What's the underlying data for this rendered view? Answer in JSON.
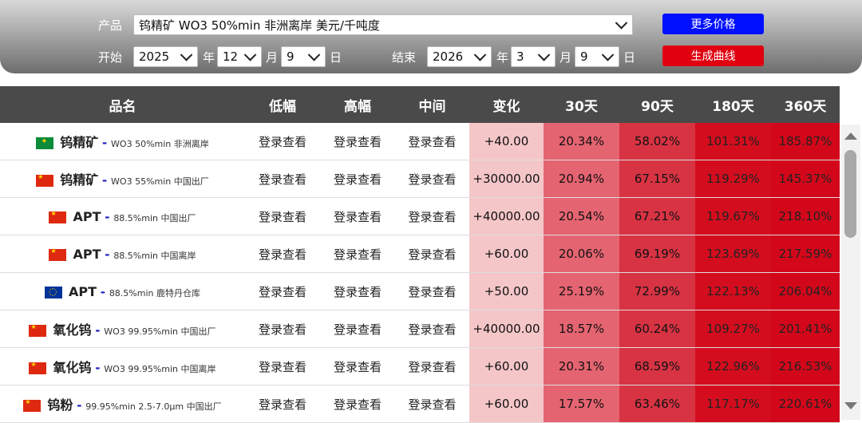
{
  "filters": {
    "product_label": "产品",
    "product_value": "钨精矿 WO3 50%min 非洲离岸 美元/千吨度",
    "start_label": "开始",
    "start_year": "2025",
    "start_month": "12",
    "start_day": "9",
    "end_label": "结束",
    "end_year": "2026",
    "end_month": "3",
    "end_day": "9",
    "year_unit": "年",
    "month_unit": "月",
    "day_unit": "日",
    "more_prices_button": "更多价格",
    "generate_curve_button": "生成曲线"
  },
  "table": {
    "headers": [
      "品名",
      "低幅",
      "高幅",
      "中间",
      "变化",
      "30天",
      "90天",
      "180天",
      "360天"
    ],
    "rows": [
      {
        "flag": "za-flag-icon",
        "name": "钨精矿",
        "spec": "WO3 50%min 非洲离岸",
        "low": "登录查看",
        "high": "登录查看",
        "mid": "登录查看",
        "change": "+40.00",
        "d30": "20.34%",
        "d90": "58.02%",
        "d180": "101.31%",
        "d360": "185.87%"
      },
      {
        "flag": "cn-flag-icon",
        "name": "钨精矿",
        "spec": "WO3 55%min 中国出厂",
        "low": "登录查看",
        "high": "登录查看",
        "mid": "登录查看",
        "change": "+30000.00",
        "d30": "20.94%",
        "d90": "67.15%",
        "d180": "119.29%",
        "d360": "145.37%"
      },
      {
        "flag": "cn-flag-icon",
        "name": "APT",
        "spec": "88.5%min 中国出厂",
        "low": "登录查看",
        "high": "登录查看",
        "mid": "登录查看",
        "change": "+40000.00",
        "d30": "20.54%",
        "d90": "67.21%",
        "d180": "119.67%",
        "d360": "218.10%"
      },
      {
        "flag": "cn-flag-icon",
        "name": "APT",
        "spec": "88.5%min 中国离岸",
        "low": "登录查看",
        "high": "登录查看",
        "mid": "登录查看",
        "change": "+60.00",
        "d30": "20.06%",
        "d90": "69.19%",
        "d180": "123.69%",
        "d360": "217.59%"
      },
      {
        "flag": "eu-flag-icon",
        "name": "APT",
        "spec": "88.5%min 鹿特丹仓库",
        "low": "登录查看",
        "high": "登录查看",
        "mid": "登录查看",
        "change": "+50.00",
        "d30": "25.19%",
        "d90": "72.99%",
        "d180": "122.13%",
        "d360": "206.04%"
      },
      {
        "flag": "cn-flag-icon",
        "name": "氧化钨",
        "spec": "WO3 99.95%min 中国出厂",
        "low": "登录查看",
        "high": "登录查看",
        "mid": "登录查看",
        "change": "+40000.00",
        "d30": "18.57%",
        "d90": "60.24%",
        "d180": "109.27%",
        "d360": "201.41%"
      },
      {
        "flag": "cn-flag-icon",
        "name": "氧化钨",
        "spec": "WO3 99.95%min 中国离岸",
        "low": "登录查看",
        "high": "登录查看",
        "mid": "登录查看",
        "change": "+60.00",
        "d30": "20.31%",
        "d90": "68.59%",
        "d180": "122.96%",
        "d360": "216.53%"
      },
      {
        "flag": "cn-flag-icon",
        "name": "钨粉",
        "spec": "99.95%min 2.5-7.0μm 中国出厂",
        "low": "登录查看",
        "high": "登录查看",
        "mid": "登录查看",
        "change": "+60.00",
        "d30": "17.57%",
        "d90": "63.46%",
        "d180": "117.17%",
        "d360": "220.61%"
      }
    ]
  },
  "colors": {
    "header_bg": "#4a4a4a",
    "change_bg": "#f5c6c8",
    "d30_bg": "#e56471",
    "d90_bg": "#d83343",
    "d180_bg": "#d40d1e",
    "d360_bg": "#d3071a",
    "more_button": "#0010ff",
    "curve_button": "#e00010"
  }
}
